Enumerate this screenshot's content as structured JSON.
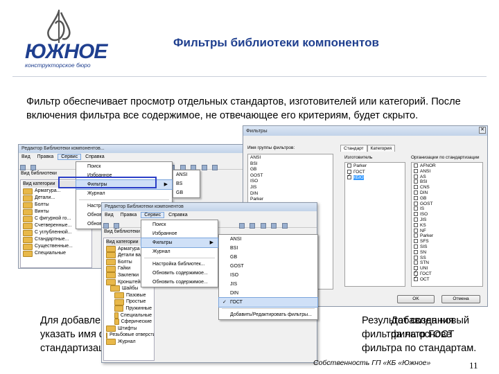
{
  "logo": {
    "name": "ЮЖНОЕ",
    "tagline": "конструкторское бюро"
  },
  "header": {
    "title": "Фильтры библиотеки компонентов"
  },
  "intro": "Фильтр обеспечивает просмотр отдельных стандартов, изготовителей или категорий. После включения фильтра все содержимое, не отвечающее его критериям, будет скрыто.",
  "bottom_lines": [
    "Для добавлен",
    "указать имя ф",
    "стандартизац"
  ],
  "overlap_text": [
    "Результат создания фильтра на основе фильтра по стандартам.",
    "Добавлен новый фильтр ГОСТ"
  ],
  "footer": {
    "text": "Собственность ГП «КБ «Южное»",
    "page": "11"
  },
  "back_window": {
    "title": "Редактор Библиотеки компонентов...",
    "menu": [
      "Вид",
      "Правка",
      "Сервис",
      "Справка"
    ],
    "tree_header": "Вид библиотеки",
    "tree_col": "Вид категории",
    "tree_items": [
      "Арматура...",
      "Детали...",
      "Болты",
      "Винты",
      "С фигурной го...",
      "Счетверенные...",
      "С углубленной...",
      "Стандартные...",
      "Существенные...",
      "Специальные"
    ],
    "menu_items": [
      "Поиск",
      "Избранное",
      "Фильтры",
      "Журнал",
      "Настройка библиотек...",
      "Обновить содержимое...",
      "Обновить содержимое..."
    ],
    "submenu_items": [
      "ANSI",
      "BS",
      "GB"
    ]
  },
  "front_window": {
    "title": "Редактор Библиотеки компонентов",
    "menu": [
      "Вид",
      "Правка",
      "Сервис",
      "Справка"
    ],
    "tree_header": "Вид библиотеки",
    "tree_col": "Вид категории",
    "tree_items": [
      "Арматура",
      "Детали вала",
      "Болты",
      "Гайки",
      "Заклепки",
      "Кронштейны",
      "Шайбы",
      "Пазовые",
      "Простые",
      "Пружинные",
      "Специальные",
      "Сферические",
      "Штифты",
      "Резьбовые отверстия",
      "Журнал"
    ],
    "menu_items": [
      "Поиск",
      "Избранное",
      "Фильтры",
      "Журнал",
      "Настройка библиотек...",
      "Обновить содержимое...",
      "Обновить содержимое..."
    ],
    "submenu_items": [
      "ANSI",
      "BSI",
      "GB",
      "GOST",
      "ISO",
      "JIS",
      "DIN",
      "ГОСТ"
    ],
    "submenu_footer": "Добавить/Редактировать фильтры..."
  },
  "filters_dialog": {
    "title": "Фильтры",
    "group_label": "Имя группы фильтров:",
    "groups": [
      "ANSI",
      "BSI",
      "GB",
      "GOST",
      "ISO",
      "JIS",
      "DIN",
      "Parker"
    ],
    "tabs": [
      "Стандарт",
      "Категория"
    ],
    "manufacturer_label": "Изготовитель",
    "manufacturers": [
      "Parker",
      "ГОСТ",
      "КБЮ"
    ],
    "org_label": "Организации по стандартизации",
    "orgs": [
      "AFNOR",
      "ANSI",
      "AS",
      "BSI",
      "CNS",
      "DIN",
      "GB",
      "GOST",
      "IS",
      "ISO",
      "JIS",
      "KS",
      "NF",
      "Parker",
      "SFS",
      "SIS",
      "SN",
      "SS",
      "STN",
      "UNI",
      "ГОСТ",
      "ОСТ"
    ],
    "ok": "OK",
    "cancel": "Отмена"
  }
}
